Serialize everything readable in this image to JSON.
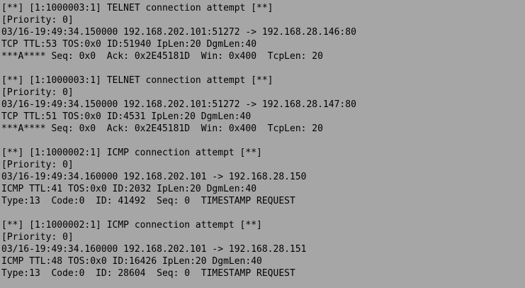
{
  "alerts": [
    {
      "header": "[**] [1:1000003:1] TELNET connection attempt [**]",
      "priority": "[Priority: 0]",
      "flow": "03/16-19:49:34.150000 192.168.202.101:51272 -> 192.168.28.146:80",
      "ip": "TCP TTL:53 TOS:0x0 ID:51940 IpLen:20 DgmLen:40",
      "detail": "***A**** Seq: 0x0  Ack: 0x2E45181D  Win: 0x400  TcpLen: 20"
    },
    {
      "header": "[**] [1:1000003:1] TELNET connection attempt [**]",
      "priority": "[Priority: 0]",
      "flow": "03/16-19:49:34.150000 192.168.202.101:51272 -> 192.168.28.147:80",
      "ip": "TCP TTL:51 TOS:0x0 ID:4531 IpLen:20 DgmLen:40",
      "detail": "***A**** Seq: 0x0  Ack: 0x2E45181D  Win: 0x400  TcpLen: 20"
    },
    {
      "header": "[**] [1:1000002:1] ICMP connection attempt [**]",
      "priority": "[Priority: 0]",
      "flow": "03/16-19:49:34.160000 192.168.202.101 -> 192.168.28.150",
      "ip": "ICMP TTL:41 TOS:0x0 ID:2032 IpLen:20 DgmLen:40",
      "detail": "Type:13  Code:0  ID: 41492  Seq: 0  TIMESTAMP REQUEST"
    },
    {
      "header": "[**] [1:1000002:1] ICMP connection attempt [**]",
      "priority": "[Priority: 0]",
      "flow": "03/16-19:49:34.160000 192.168.202.101 -> 192.168.28.151",
      "ip": "ICMP TTL:48 TOS:0x0 ID:16426 IpLen:20 DgmLen:40",
      "detail": "Type:13  Code:0  ID: 28604  Seq: 0  TIMESTAMP REQUEST"
    }
  ],
  "colors": {
    "background": "#a6a6a6",
    "text": "#000000"
  }
}
